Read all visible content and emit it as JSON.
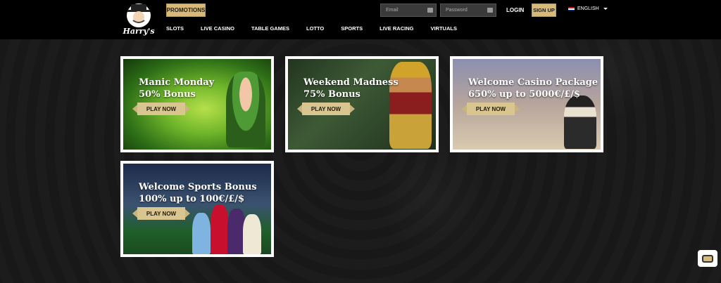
{
  "header": {
    "logo_text": "Harry's",
    "promotions_label": "PROMOTIONS",
    "email_placeholder": "Email",
    "password_placeholder": "Password",
    "login_label": "LOGIN",
    "signup_label": "SIGN UP",
    "language_label": "ENGLISH",
    "nav": [
      "SLOTS",
      "LIVE CASINO",
      "TABLE GAMES",
      "LOTTO",
      "SPORTS",
      "LIVE RACING",
      "VIRTUALS"
    ]
  },
  "promos": [
    {
      "title_line1": "Manic Monday",
      "title_line2": "50% Bonus",
      "button": "PLAY NOW"
    },
    {
      "title_line1": "Weekend Madness",
      "title_line2": "75% Bonus",
      "button": "PLAY NOW"
    },
    {
      "title_line1": "Welcome Casino Package",
      "title_line2": "650% up to 5000€/£/$",
      "button": "PLAY NOW"
    },
    {
      "title_line1": "Welcome Sports Bonus",
      "title_line2": "100% up to 100€/£/$",
      "button": "PLAY NOW"
    }
  ],
  "colors": {
    "accent": "#d8b978",
    "header_bg": "#000000",
    "page_bg": "#1a1a1a"
  },
  "icons": {
    "chat": "chat-bubble-icon",
    "flag": "uk-flag-icon",
    "keyboard": "keyboard-icon"
  }
}
